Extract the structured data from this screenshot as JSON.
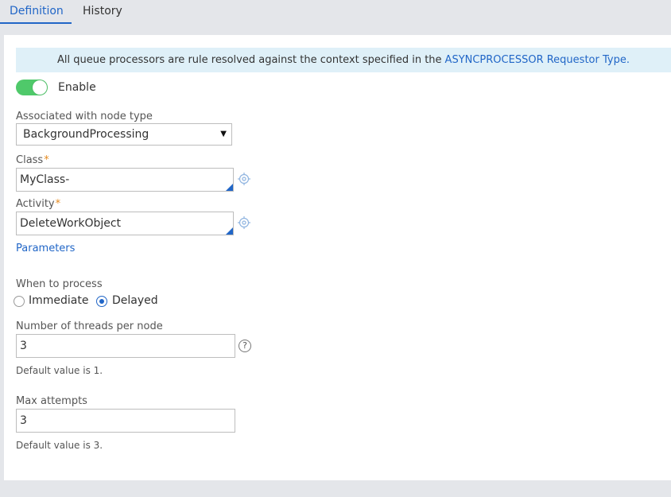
{
  "tabs": [
    {
      "label": "Definition",
      "active": true
    },
    {
      "label": "History",
      "active": false
    }
  ],
  "banner": {
    "text": "All queue processors are rule resolved against the context specified in the",
    "link": "ASYNCPROCESSOR Requestor Type",
    "suffix": "."
  },
  "enable": {
    "label": "Enable",
    "on": true
  },
  "node_type": {
    "label": "Associated with node type",
    "value": "BackgroundProcessing"
  },
  "class_field": {
    "label": "Class",
    "required_mark": "*",
    "value": "MyClass-"
  },
  "activity_field": {
    "label": "Activity",
    "required_mark": "*",
    "value": "DeleteWorkObject"
  },
  "parameters_link": "Parameters",
  "when_to_process": {
    "label": "When to process",
    "options": [
      {
        "label": "Immediate",
        "selected": false
      },
      {
        "label": "Delayed",
        "selected": true
      }
    ]
  },
  "threads": {
    "label": "Number of threads per node",
    "value": "3",
    "hint": "Default value is 1.",
    "help_icon": "?"
  },
  "max_attempts": {
    "label": "Max attempts",
    "value": "3",
    "hint": "Default value is 3."
  },
  "colors": {
    "accent": "#2166c7",
    "toggle_on": "#4fc96a",
    "banner_bg": "#dff0f8",
    "required": "#e58a1f"
  }
}
